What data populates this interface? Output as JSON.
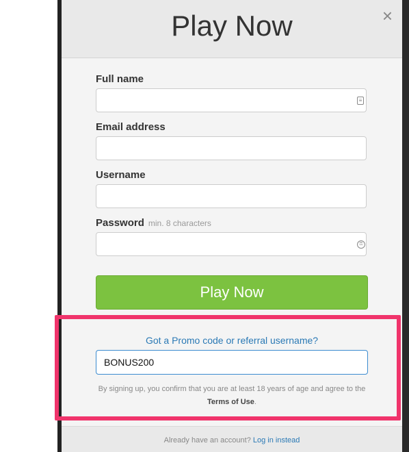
{
  "modal": {
    "title": "Play Now",
    "close_label": "×"
  },
  "form": {
    "full_name": {
      "label": "Full name",
      "value": "",
      "icon": "contact-card-icon"
    },
    "email": {
      "label": "Email address",
      "value": ""
    },
    "username": {
      "label": "Username",
      "value": ""
    },
    "password": {
      "label": "Password",
      "hint": "min. 8 characters",
      "value": "",
      "icon": "key-icon"
    },
    "submit_label": "Play Now"
  },
  "promo": {
    "link_text": "Got a Promo code or referral username?",
    "value": "BONUS200"
  },
  "terms": {
    "text_before": "By signing up, you confirm that you are at least 18 years of age and agree to the ",
    "terms_link": "Terms of Use",
    "text_after": "."
  },
  "footer": {
    "prompt": "Already have an account? ",
    "login_link": "Log in instead"
  },
  "colors": {
    "accent_green": "#7cc240",
    "highlight_pink": "#f0346b",
    "link_blue": "#2a79b5"
  }
}
